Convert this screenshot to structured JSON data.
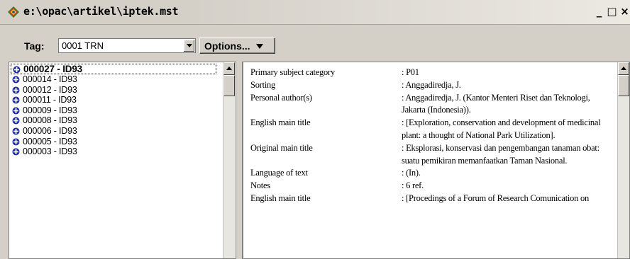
{
  "window": {
    "title": "e:\\opac\\artikel\\iptek.mst",
    "buttons": [
      "_",
      "□",
      "×"
    ]
  },
  "toolbar": {
    "tag_label": "Tag:",
    "tag_value": "0001 TRN",
    "options_label": "Options..."
  },
  "records_list": [
    "000027 - ID93",
    "000014 - ID93",
    "000012 - ID93",
    "000011 - ID93",
    "000009 - ID93",
    "000008 - ID93",
    "000006 - ID93",
    "000005 - ID93",
    "000003 - ID93"
  ],
  "selected_record_index": 0,
  "record_detail": [
    {
      "label": "Primary subject category",
      "value": ": P01"
    },
    {
      "label": "Sorting",
      "value": ": Anggadiredja, J."
    },
    {
      "label": "Personal author(s)",
      "value": ": Anggadiredja, J. (Kantor Menteri Riset dan Teknologi, Jakarta (Indonesia))."
    },
    {
      "label": "English main title",
      "value": ": [Exploration, conservation and development of medicinal plant: a thought of National Park Utilization]."
    },
    {
      "label": "Original main title",
      "value": ": Eksplorasi, konservasi dan pengembangan tanaman obat: suatu pemikiran memanfaatkan Taman Nasional."
    },
    {
      "label": "Language of text",
      "value": ": (In)."
    },
    {
      "label": "Notes",
      "value": ": 6 ref."
    },
    {
      "label": "English main title",
      "value": ": [Procedings of a Forum of Research Comunication on"
    }
  ],
  "icons": {
    "app": "opac-app-icon",
    "tree_bullet": "expand-bullet-icon"
  },
  "colors": {
    "chrome": "#d4d0c8",
    "pane_bg": "#ffffff",
    "bullet_blue": "#1a2a9a"
  }
}
